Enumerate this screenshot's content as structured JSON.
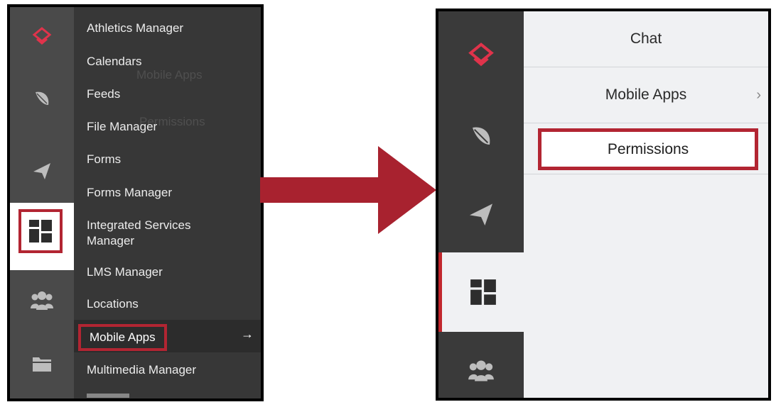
{
  "left_panel": {
    "rail_icons": [
      "logo-icon",
      "feather-icon",
      "paper-plane-icon",
      "dashboard-icon",
      "group-icon",
      "folder-icon"
    ],
    "menu_items": [
      "Athletics Manager",
      "Calendars",
      "Feeds",
      "File Manager",
      "Forms",
      "Forms Manager",
      "Integrated Services Manager",
      "LMS Manager",
      "Locations",
      "Mobile Apps",
      "Multimedia Manager"
    ],
    "ghost_items": [
      "Mobile Apps",
      "Permissions"
    ],
    "selected_item": "Mobile Apps",
    "selected_arrow": "→"
  },
  "right_panel": {
    "rail_icons": [
      "logo-icon",
      "feather-icon",
      "paper-plane-icon",
      "dashboard-icon",
      "group-icon"
    ],
    "rows": [
      "Chat",
      "Mobile Apps",
      "Permissions"
    ],
    "chevron": "›"
  },
  "colors": {
    "highlight": "#b22532",
    "arrow": "#a8222f",
    "brand": "#e0334b",
    "dark_menu": "#373737",
    "rail": "#4a4a4a"
  }
}
